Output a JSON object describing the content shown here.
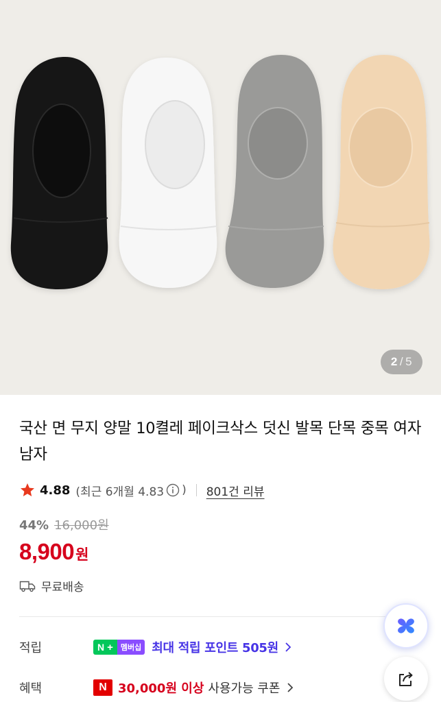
{
  "gallery": {
    "current": "2",
    "separator": "/",
    "total": "5",
    "sock_colors": [
      "#151515",
      "#f7f7f7",
      "#9a9a98",
      "#f2d6b3"
    ]
  },
  "product": {
    "title": "국산 면 무지 양말 10켤레 페이크삭스 덧신 발목 단목 중목 여자 남자"
  },
  "rating": {
    "score": "4.88",
    "recent_open": "(최근 6개월 4.83",
    "recent_close": ")",
    "reviews": "801건 리뷰"
  },
  "price": {
    "discount_rate": "44%",
    "original": "16,000원",
    "sale": "8,900",
    "currency": "원"
  },
  "shipping": {
    "label": "무료배송"
  },
  "benefits": {
    "points_label": "적립",
    "npay_n": "N",
    "npay_plus": "+",
    "membership": "멤버십",
    "points_text": "최대 적립 포인트 505원",
    "coupon_label": "혜택",
    "coupon_badge": "N",
    "coupon_strong": "30,000원 이상",
    "coupon_rest": "사용가능 쿠폰"
  },
  "colors": {
    "price_red": "#d6001c",
    "points_purple": "#4734e6",
    "naver_green": "#03c75a",
    "membership_purple": "#8a4dff"
  },
  "icons": [
    "star-icon",
    "info-icon",
    "truck-icon",
    "chevron-right-icon",
    "ai-assistant-icon",
    "share-icon"
  ]
}
